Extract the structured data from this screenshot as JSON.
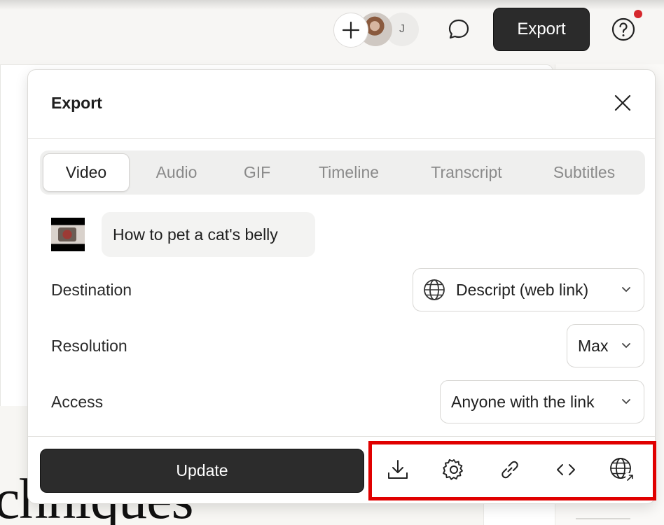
{
  "topbar": {
    "add_icon": "plus-icon",
    "collaborator_initial": "J",
    "comment_icon": "speech-bubble-icon",
    "export_label": "Export",
    "help_icon": "question-circle-icon",
    "notification_color": "#d6282d"
  },
  "background": {
    "serif_text": "chniques"
  },
  "modal": {
    "title": "Export",
    "close_icon": "close-icon",
    "tabs": [
      {
        "label": "Video",
        "active": true
      },
      {
        "label": "Audio",
        "active": false
      },
      {
        "label": "GIF",
        "active": false
      },
      {
        "label": "Timeline",
        "active": false
      },
      {
        "label": "Transcript",
        "active": false
      },
      {
        "label": "Subtitles",
        "active": false
      }
    ],
    "composition_title": "How to pet a cat's belly",
    "destination": {
      "label": "Destination",
      "value": "Descript (web link)",
      "icon": "globe-icon"
    },
    "resolution": {
      "label": "Resolution",
      "value": "Max"
    },
    "access": {
      "label": "Access",
      "value": "Anyone with the link"
    },
    "update_label": "Update",
    "footer_tools": [
      "download-icon",
      "settings-gear-icon",
      "link-icon",
      "embed-code-icon",
      "publish-web-icon"
    ]
  },
  "colors": {
    "primary_button": "#2c2c2c",
    "highlight_box": "#e00000"
  }
}
